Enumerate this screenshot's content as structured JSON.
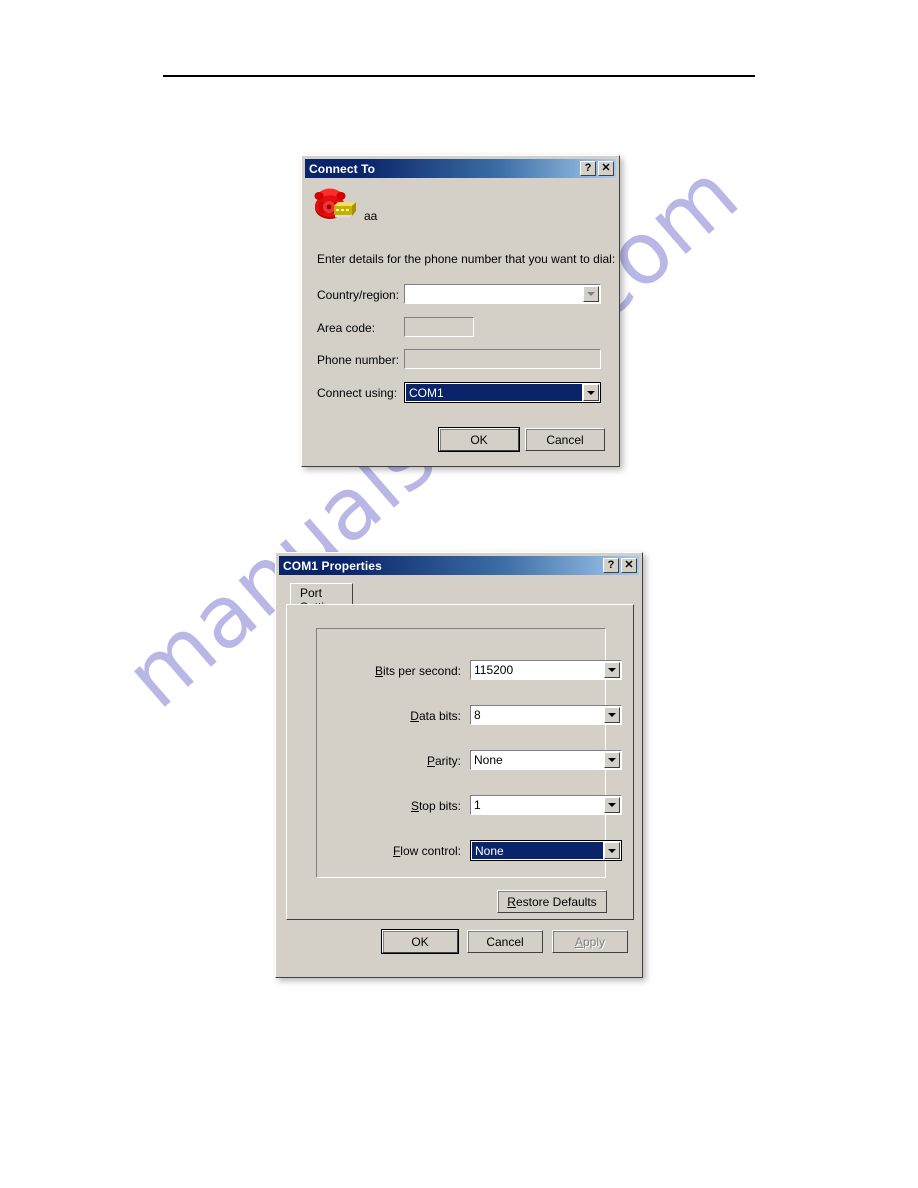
{
  "page": {
    "watermark": "manualshive.com",
    "has_header_rule": true
  },
  "connect_to_dialog": {
    "title": "Connect To",
    "titlebar_buttons": [
      {
        "name": "help",
        "glyph": "?"
      },
      {
        "name": "close",
        "glyph": "✕"
      }
    ],
    "connection_icon": "phone-modem-icon",
    "connection_name": "aa",
    "instruction": "Enter details for the phone number that you want to dial:",
    "fields": [
      {
        "id": "country-region",
        "label": "Country/region:",
        "value": "",
        "control": "combobox",
        "enabled": false,
        "focused": false
      },
      {
        "id": "area-code",
        "label": "Area code:",
        "value": "",
        "control": "textbox",
        "enabled": false,
        "focused": false
      },
      {
        "id": "phone-number",
        "label": "Phone number:",
        "value": "",
        "control": "textbox",
        "enabled": false,
        "focused": false
      },
      {
        "id": "connect-using",
        "label": "Connect using:",
        "value": "COM1",
        "control": "combobox",
        "enabled": true,
        "focused": true
      }
    ],
    "buttons": [
      {
        "id": "ok",
        "label": "OK",
        "default": true,
        "enabled": true
      },
      {
        "id": "cancel",
        "label": "Cancel",
        "default": false,
        "enabled": true
      }
    ]
  },
  "com1_properties_dialog": {
    "title": "COM1 Properties",
    "titlebar_buttons": [
      {
        "name": "help",
        "glyph": "?"
      },
      {
        "name": "close",
        "glyph": "✕"
      }
    ],
    "tabs": [
      {
        "id": "port-settings",
        "label": "Port Settings",
        "active": true
      }
    ],
    "settings": [
      {
        "id": "bits-per-second",
        "label_prefix": "",
        "label_accel": "B",
        "label_suffix": "its per second:",
        "value": "115200",
        "focused": false
      },
      {
        "id": "data-bits",
        "label_prefix": "",
        "label_accel": "D",
        "label_suffix": "ata bits:",
        "value": "8",
        "focused": false
      },
      {
        "id": "parity",
        "label_prefix": "",
        "label_accel": "P",
        "label_suffix": "arity:",
        "value": "None",
        "focused": false
      },
      {
        "id": "stop-bits",
        "label_prefix": "",
        "label_accel": "S",
        "label_suffix": "top bits:",
        "value": "1",
        "focused": false
      },
      {
        "id": "flow-control",
        "label_prefix": "",
        "label_accel": "F",
        "label_suffix": "low control:",
        "value": "None",
        "focused": true
      }
    ],
    "restore_defaults": {
      "label_accel": "R",
      "label_suffix": "estore Defaults"
    },
    "buttons": [
      {
        "id": "ok",
        "label": "OK",
        "default": true,
        "enabled": true
      },
      {
        "id": "cancel",
        "label": "Cancel",
        "default": false,
        "enabled": true
      },
      {
        "id": "apply",
        "label": "Apply",
        "default": false,
        "enabled": false,
        "accel": "A"
      }
    ]
  },
  "colors": {
    "dialog_face": "#d4d0c8",
    "titlebar_start": "#0a246a",
    "titlebar_end": "#a6caf0",
    "selection": "#0a246a",
    "watermark": "#b9b7e6",
    "disabled_text": "#808080"
  }
}
